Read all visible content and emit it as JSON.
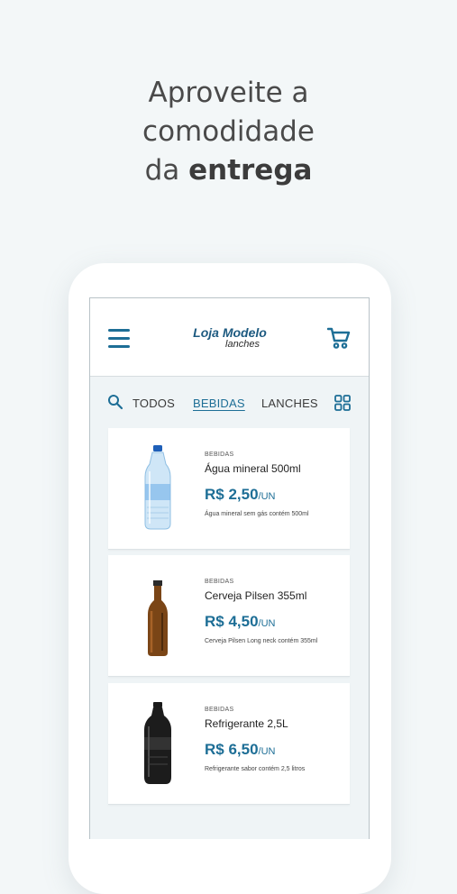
{
  "headline": {
    "line1": "Aproveite a",
    "line2": "comodidade",
    "line3_prefix": "da ",
    "line3_bold": "entrega"
  },
  "appbar": {
    "logo_title": "Loja Modelo",
    "logo_subtitle": "lanches"
  },
  "tabs": [
    {
      "label": "TODOS",
      "active": false
    },
    {
      "label": "BEBIDAS",
      "active": true
    },
    {
      "label": "LANCHES",
      "active": false
    }
  ],
  "products": [
    {
      "category": "BEBIDAS",
      "name": "Água mineral 500ml",
      "price": "R$ 2,50",
      "unit": "/UN",
      "description": "Água mineral sem gás contém 500ml",
      "image": "water-bottle"
    },
    {
      "category": "BEBIDAS",
      "name": "Cerveja Pilsen 355ml",
      "price": "R$ 4,50",
      "unit": "/UN",
      "description": "Cerveja Pilsen Long neck contém 355ml",
      "image": "beer-bottle"
    },
    {
      "category": "BEBIDAS",
      "name": "Refrigerante 2,5L",
      "price": "R$ 6,50",
      "unit": "/UN",
      "description": "Refrigerante sabor contém 2,5 litros",
      "image": "soda-bottle"
    }
  ],
  "colors": {
    "accent": "#1d6e96",
    "background": "#f3f7f8"
  }
}
